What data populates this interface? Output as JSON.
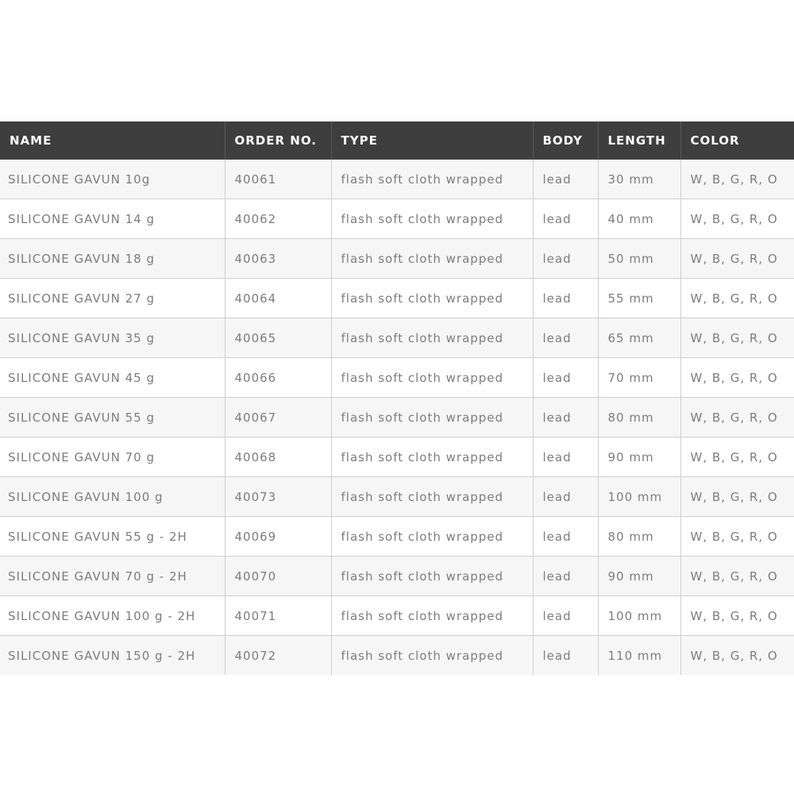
{
  "table": {
    "columns": [
      "NAME",
      "ORDER NO.",
      "TYPE",
      "BODY",
      "LENGTH",
      "COLOR"
    ],
    "rows": [
      [
        "SILICONE GAVUN 10g",
        "40061",
        "flash soft cloth wrapped",
        "lead",
        "30 mm",
        "W, B, G, R, O"
      ],
      [
        "SILICONE GAVUN 14 g",
        "40062",
        "flash soft cloth wrapped",
        "lead",
        "40 mm",
        "W, B, G, R, O"
      ],
      [
        "SILICONE GAVUN 18 g",
        "40063",
        "flash soft cloth wrapped",
        "lead",
        "50 mm",
        "W, B, G, R, O"
      ],
      [
        "SILICONE GAVUN 27 g",
        "40064",
        "flash soft cloth wrapped",
        "lead",
        "55 mm",
        "W, B, G, R, O"
      ],
      [
        "SILICONE GAVUN 35 g",
        "40065",
        "flash soft cloth wrapped",
        "lead",
        "65 mm",
        "W, B, G, R, O"
      ],
      [
        "SILICONE GAVUN 45 g",
        "40066",
        "flash soft cloth wrapped",
        "lead",
        "70 mm",
        "W, B, G, R, O"
      ],
      [
        "SILICONE GAVUN 55 g",
        "40067",
        "flash soft cloth wrapped",
        "lead",
        "80 mm",
        "W, B, G, R, O"
      ],
      [
        "SILICONE GAVUN 70 g",
        "40068",
        "flash soft cloth wrapped",
        "lead",
        "90 mm",
        "W, B, G, R, O"
      ],
      [
        "SILICONE GAVUN 100 g",
        "40073",
        "flash soft cloth wrapped",
        "lead",
        "100 mm",
        "W, B, G, R, O"
      ],
      [
        "SILICONE GAVUN 55 g - 2H",
        "40069",
        "flash soft cloth wrapped",
        "lead",
        "80 mm",
        "W, B, G, R, O"
      ],
      [
        "SILICONE GAVUN 70 g - 2H",
        "40070",
        "flash soft cloth wrapped",
        "lead",
        "90 mm",
        "W, B, G, R, O"
      ],
      [
        "SILICONE GAVUN 100 g - 2H",
        "40071",
        "flash soft cloth wrapped",
        "lead",
        "100 mm",
        "W, B, G, R, O"
      ],
      [
        "SILICONE GAVUN 150 g - 2H",
        "40072",
        "flash soft cloth wrapped",
        "lead",
        "110 mm",
        "W, B, G, R, O"
      ]
    ]
  },
  "colors": {
    "header_background": "#3f3e3e",
    "header_text": "#ffffff",
    "row_stripe": "#f6f6f6",
    "cell_text": "#7d7d7d",
    "grid_line": "#cfcfcf"
  }
}
